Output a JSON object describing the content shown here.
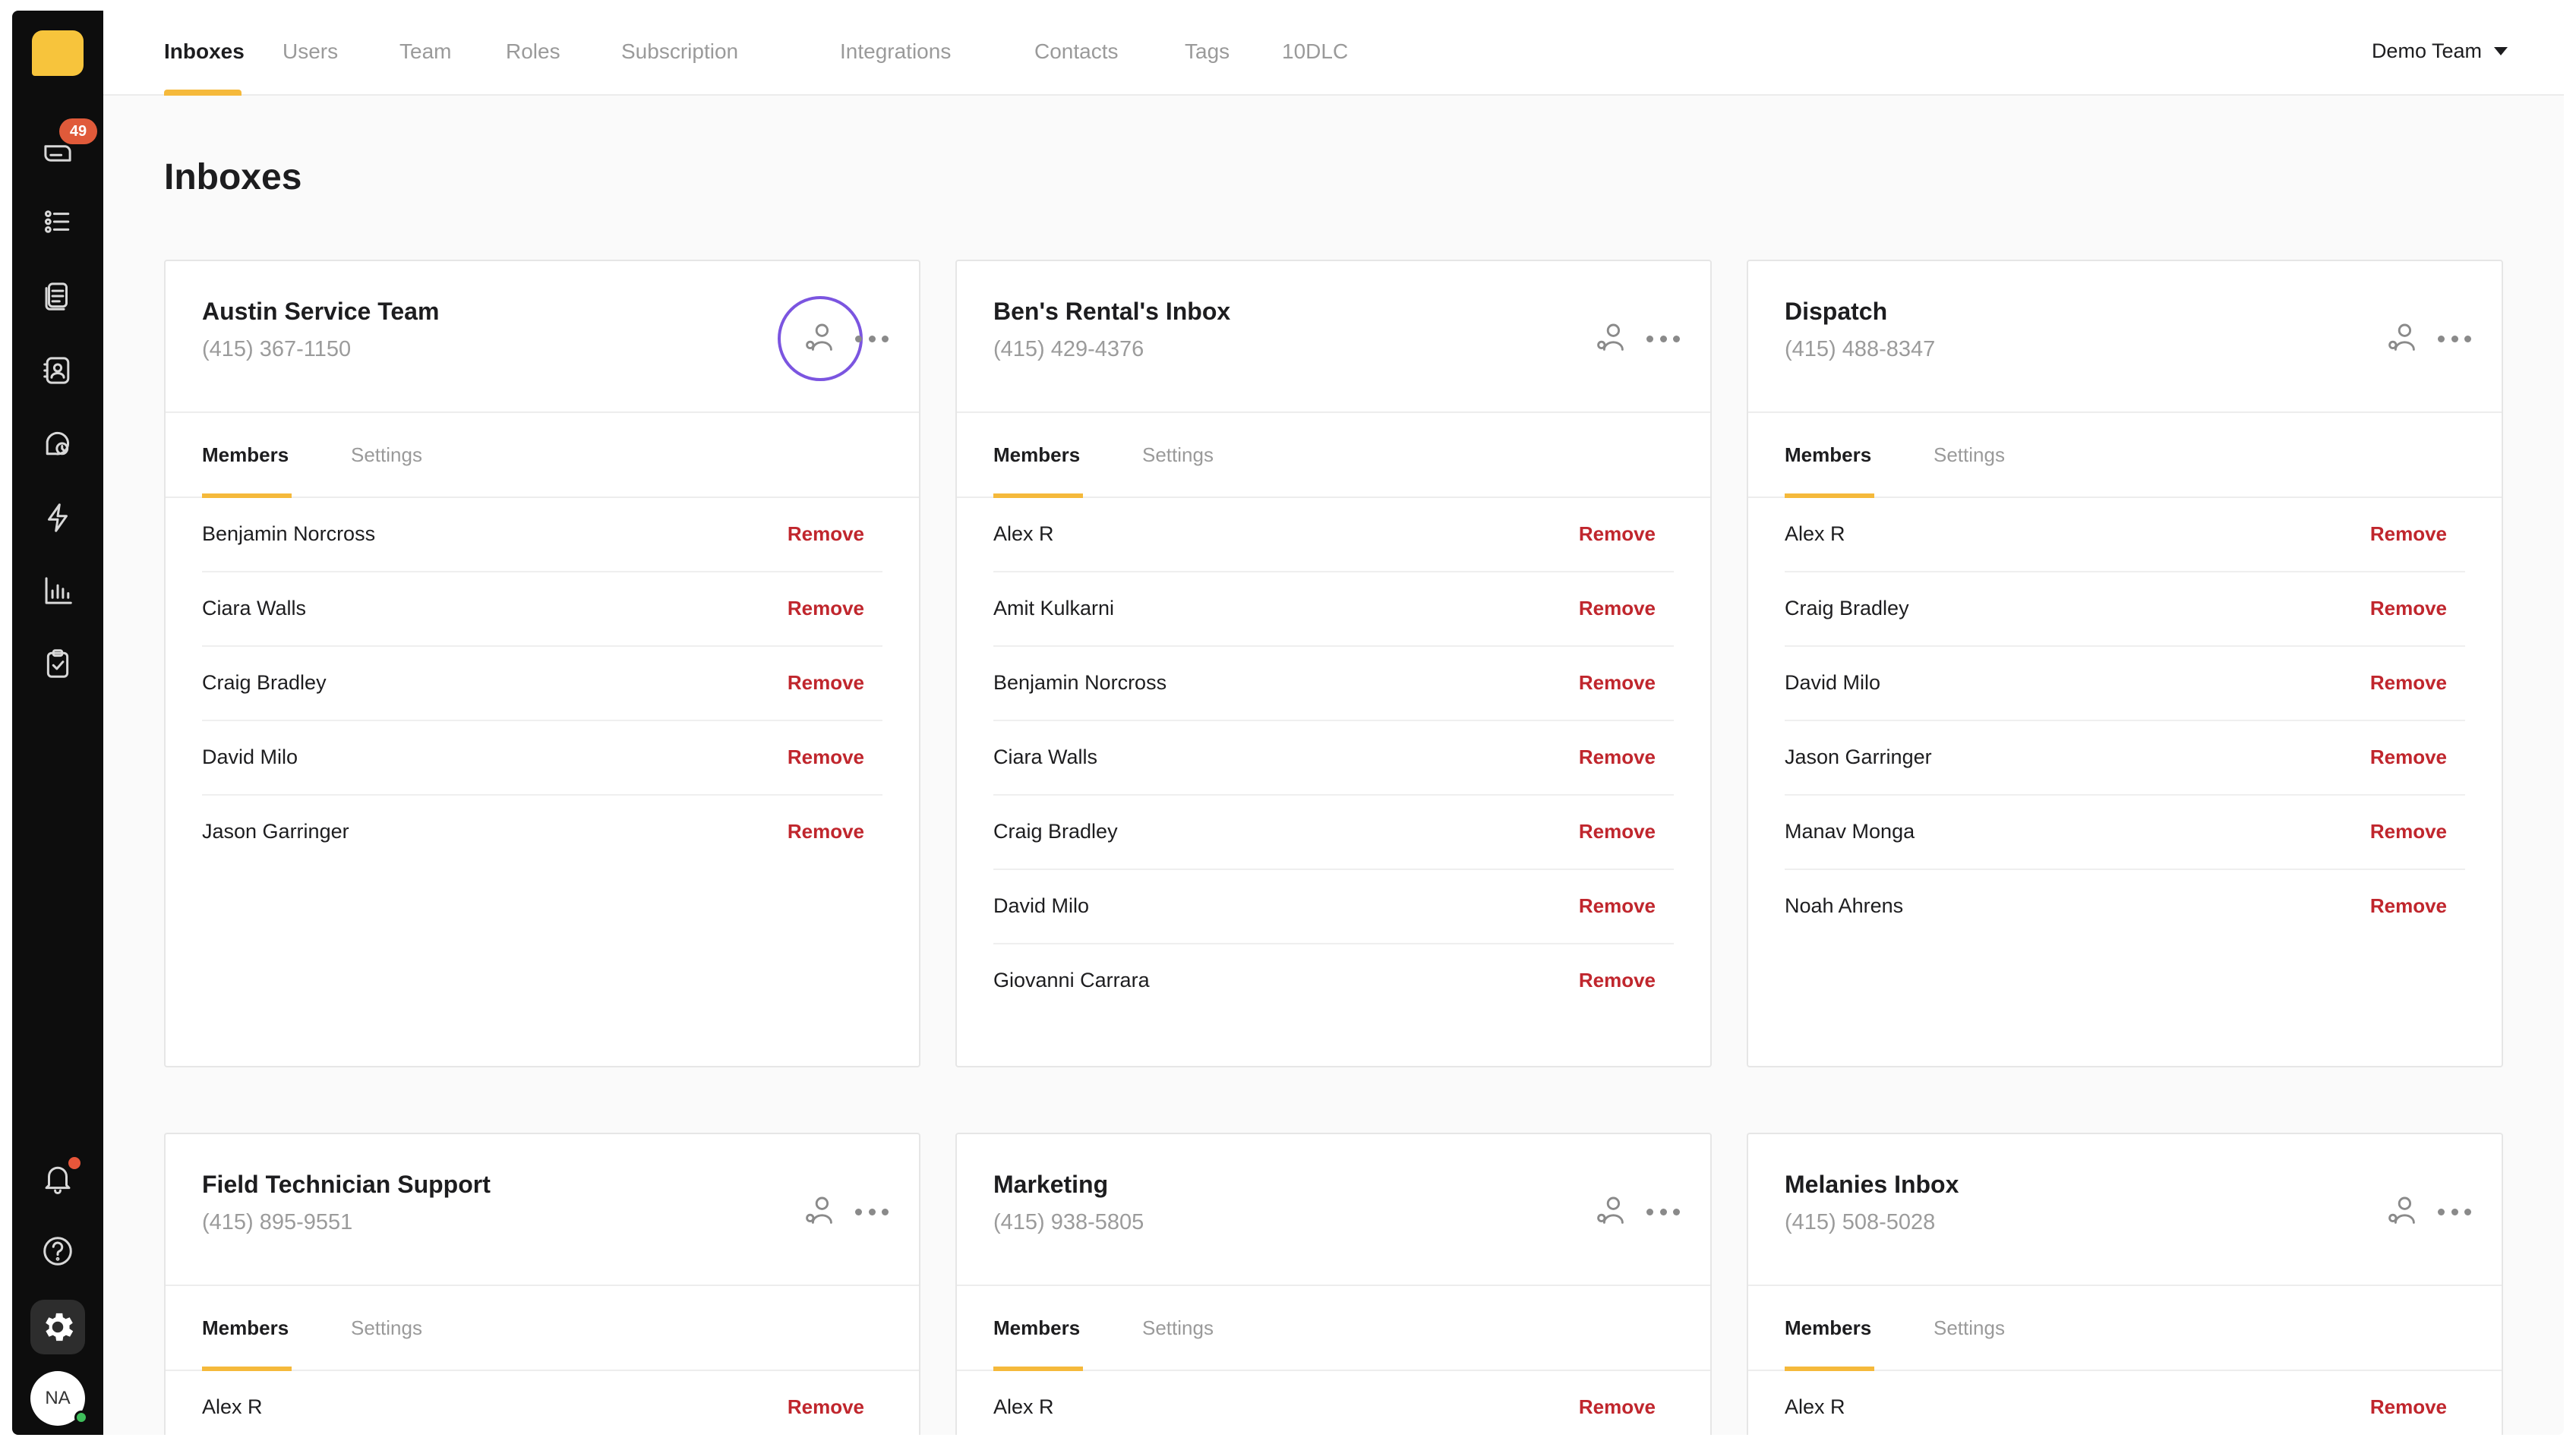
{
  "rail": {
    "unread_count": "49",
    "avatar_initials": "NA"
  },
  "nav": {
    "tabs": [
      "Inboxes",
      "Users",
      "Team",
      "Roles",
      "Subscription",
      "Integrations",
      "Contacts",
      "Tags",
      "10DLC"
    ],
    "active_tab": "Inboxes",
    "team_selector": "Demo Team"
  },
  "page": {
    "title": "Inboxes"
  },
  "card_tabs": {
    "members": "Members",
    "settings": "Settings"
  },
  "remove_label": "Remove",
  "inboxes": [
    {
      "name": "Austin Service Team",
      "phone": "(415) 367-1150",
      "members": [
        "Benjamin Norcross",
        "Ciara Walls",
        "Craig Bradley",
        "David Milo",
        "Jason Garringer"
      ]
    },
    {
      "name": "Ben's Rental's Inbox",
      "phone": "(415) 429-4376",
      "members": [
        "Alex R",
        "Amit Kulkarni",
        "Benjamin Norcross",
        "Ciara Walls",
        "Craig Bradley",
        "David Milo",
        "Giovanni Carrara"
      ]
    },
    {
      "name": "Dispatch",
      "phone": "(415) 488-8347",
      "members": [
        "Alex R",
        "Craig Bradley",
        "David Milo",
        "Jason Garringer",
        "Manav Monga",
        "Noah Ahrens"
      ]
    },
    {
      "name": "Field Technician Support",
      "phone": "(415) 895-9551",
      "members": [
        "Alex R"
      ]
    },
    {
      "name": "Marketing",
      "phone": "(415) 938-5805",
      "members": [
        "Alex R"
      ]
    },
    {
      "name": "Melanies Inbox",
      "phone": "(415) 508-5028",
      "members": [
        "Alex R"
      ]
    }
  ],
  "colors": {
    "accent": "#f5b93b",
    "remove": "#c0262d",
    "focus_ring": "#7b55e0",
    "rail_bg": "#0d0d0d"
  }
}
